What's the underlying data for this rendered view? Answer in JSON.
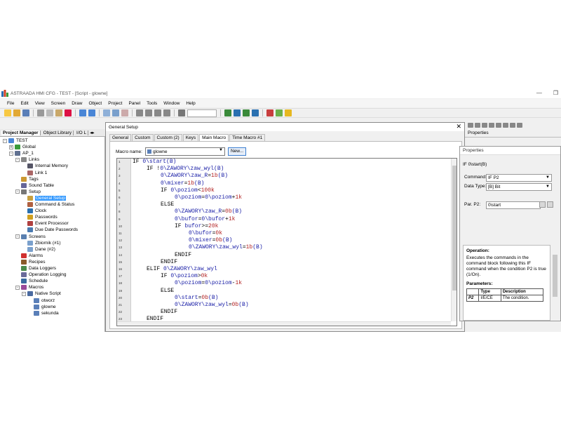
{
  "window": {
    "title": "ASTRAADA HMI CFG - TEST - [Script - glowne]",
    "menu": [
      "File",
      "Edit",
      "View",
      "Screen",
      "Draw",
      "Object",
      "Project",
      "Panel",
      "Tools",
      "Window",
      "Help"
    ]
  },
  "project_manager": {
    "tabs": [
      "Project Manager",
      "Object Library",
      "I/O L"
    ],
    "tree": [
      {
        "label": "TEST",
        "level": 0,
        "icon": "project-icon",
        "exp": "-"
      },
      {
        "label": "Global",
        "level": 1,
        "icon": "globe-icon",
        "exp": "+"
      },
      {
        "label": "AP_1",
        "level": 1,
        "icon": "device-icon",
        "exp": "-"
      },
      {
        "label": "Links",
        "level": 2,
        "icon": "links-icon",
        "exp": "-"
      },
      {
        "label": "Internal Memory",
        "level": 3,
        "icon": "memory-icon",
        "exp": ""
      },
      {
        "label": "Link 1",
        "level": 3,
        "icon": "link-icon",
        "exp": ""
      },
      {
        "label": "Tags",
        "level": 2,
        "icon": "tags-icon",
        "exp": ""
      },
      {
        "label": "Sound Table",
        "level": 2,
        "icon": "sound-icon",
        "exp": ""
      },
      {
        "label": "Setup",
        "level": 2,
        "icon": "setup-icon",
        "exp": "-"
      },
      {
        "label": "General Setup",
        "level": 3,
        "icon": "general-setup-icon",
        "exp": "",
        "selected": true
      },
      {
        "label": "Command & Status",
        "level": 3,
        "icon": "command-icon",
        "exp": ""
      },
      {
        "label": "Clock",
        "level": 3,
        "icon": "clock-icon",
        "exp": ""
      },
      {
        "label": "Passwords",
        "level": 3,
        "icon": "key-icon",
        "exp": ""
      },
      {
        "label": "Event Processor",
        "level": 3,
        "icon": "event-icon",
        "exp": ""
      },
      {
        "label": "Due Date Passwords",
        "level": 3,
        "icon": "calendar-icon",
        "exp": ""
      },
      {
        "label": "Screens",
        "level": 2,
        "icon": "screens-icon",
        "exp": "-"
      },
      {
        "label": "Zbiornik (#1)",
        "level": 3,
        "icon": "screen-icon",
        "exp": ""
      },
      {
        "label": "Dane (#2)",
        "level": 3,
        "icon": "screen-icon",
        "exp": ""
      },
      {
        "label": "Alarms",
        "level": 2,
        "icon": "alarm-icon",
        "exp": ""
      },
      {
        "label": "Recipes",
        "level": 2,
        "icon": "recipe-icon",
        "exp": ""
      },
      {
        "label": "Data Loggers",
        "level": 2,
        "icon": "logger-icon",
        "exp": ""
      },
      {
        "label": "Operation Logging",
        "level": 2,
        "icon": "oplog-icon",
        "exp": ""
      },
      {
        "label": "Schedule",
        "level": 2,
        "icon": "schedule-icon",
        "exp": ""
      },
      {
        "label": "Macros",
        "level": 2,
        "icon": "macro-icon",
        "exp": "-"
      },
      {
        "label": "Native Script",
        "level": 3,
        "icon": "script-icon",
        "exp": "-"
      },
      {
        "label": "otworz",
        "level": 4,
        "icon": "script-file-icon",
        "exp": ""
      },
      {
        "label": "glowne",
        "level": 4,
        "icon": "script-file-icon",
        "exp": ""
      },
      {
        "label": "sekunda",
        "level": 4,
        "icon": "script-file-icon",
        "exp": ""
      }
    ]
  },
  "dialog": {
    "title": "General Setup",
    "tabs": [
      "General",
      "Custom",
      "Custom (2)",
      "Keys",
      "Main Macro",
      "Time Macro #1"
    ],
    "active_tab": 4,
    "macro_name_label": "Macro name:",
    "macro_name_value": "glowne",
    "new_button": "New...",
    "code": [
      {
        "indent": 0,
        "parts": [
          [
            "kw",
            "IF "
          ],
          [
            "id",
            "0\\start(B)"
          ]
        ]
      },
      {
        "indent": 1,
        "parts": [
          [
            "kw",
            "IF !"
          ],
          [
            "id",
            "0\\ZAWORY\\zaw_wyl(B)"
          ]
        ]
      },
      {
        "indent": 2,
        "parts": [
          [
            "id",
            "0\\ZAWORY\\zaw_R"
          ],
          [
            "kw",
            "="
          ],
          [
            "num",
            "1b"
          ],
          [
            "id",
            "(B)"
          ]
        ]
      },
      {
        "indent": 2,
        "parts": [
          [
            "id",
            "0\\mixer"
          ],
          [
            "kw",
            "="
          ],
          [
            "num",
            "1b"
          ],
          [
            "id",
            "(B)"
          ]
        ]
      },
      {
        "indent": 2,
        "parts": [
          [
            "kw",
            "IF "
          ],
          [
            "id",
            "0\\poziom"
          ],
          [
            "kw",
            "<"
          ],
          [
            "num",
            "100k"
          ]
        ]
      },
      {
        "indent": 3,
        "parts": [
          [
            "id",
            "0\\poziom"
          ],
          [
            "kw",
            "="
          ],
          [
            "id",
            "0\\poziom"
          ],
          [
            "kw",
            "+"
          ],
          [
            "num",
            "1k"
          ]
        ]
      },
      {
        "indent": 2,
        "parts": [
          [
            "kw",
            "ELSE"
          ]
        ]
      },
      {
        "indent": 3,
        "parts": [
          [
            "id",
            "0\\ZAWORY\\zaw_R"
          ],
          [
            "kw",
            "="
          ],
          [
            "num",
            "0b"
          ],
          [
            "id",
            "(B)"
          ]
        ]
      },
      {
        "indent": 3,
        "parts": [
          [
            "id",
            "0\\bufor"
          ],
          [
            "kw",
            "="
          ],
          [
            "id",
            "0\\bufor"
          ],
          [
            "kw",
            "+"
          ],
          [
            "num",
            "1k"
          ]
        ]
      },
      {
        "indent": 3,
        "parts": [
          [
            "kw",
            "IF "
          ],
          [
            "id",
            "bufor"
          ],
          [
            "kw",
            ">="
          ],
          [
            "num",
            "20k"
          ]
        ]
      },
      {
        "indent": 4,
        "parts": [
          [
            "id",
            "0\\bufor"
          ],
          [
            "kw",
            "="
          ],
          [
            "num",
            "0k"
          ]
        ]
      },
      {
        "indent": 4,
        "parts": [
          [
            "id",
            "0\\mixer"
          ],
          [
            "kw",
            "="
          ],
          [
            "num",
            "0b"
          ],
          [
            "id",
            "(B)"
          ]
        ]
      },
      {
        "indent": 4,
        "parts": [
          [
            "id",
            "0\\ZAWORY\\zaw_wyl"
          ],
          [
            "kw",
            "="
          ],
          [
            "num",
            "1b"
          ],
          [
            "id",
            "(B)"
          ]
        ]
      },
      {
        "indent": 3,
        "parts": [
          [
            "kw",
            "ENDIF"
          ]
        ]
      },
      {
        "indent": 2,
        "parts": [
          [
            "kw",
            "ENDIF"
          ]
        ]
      },
      {
        "indent": 1,
        "parts": [
          [
            "kw",
            "ELIF "
          ],
          [
            "id",
            "0\\ZAWORY\\zaw_wyl"
          ]
        ]
      },
      {
        "indent": 2,
        "parts": [
          [
            "kw",
            "IF "
          ],
          [
            "id",
            "0\\poziom"
          ],
          [
            "kw",
            ">"
          ],
          [
            "num",
            "0k"
          ]
        ]
      },
      {
        "indent": 3,
        "parts": [
          [
            "id",
            "0\\poziom"
          ],
          [
            "kw",
            "="
          ],
          [
            "id",
            "0\\poziom"
          ],
          [
            "kw",
            "-"
          ],
          [
            "num",
            "1k"
          ]
        ]
      },
      {
        "indent": 2,
        "parts": [
          [
            "kw",
            "ELSE"
          ]
        ]
      },
      {
        "indent": 3,
        "parts": [
          [
            "id",
            "0\\start"
          ],
          [
            "kw",
            "="
          ],
          [
            "num",
            "0b"
          ],
          [
            "id",
            "(B)"
          ]
        ]
      },
      {
        "indent": 3,
        "parts": [
          [
            "id",
            "0\\ZAWORY\\zaw_wyl"
          ],
          [
            "kw",
            "="
          ],
          [
            "num",
            "0b"
          ],
          [
            "id",
            "(B)"
          ]
        ]
      },
      {
        "indent": 2,
        "parts": [
          [
            "kw",
            "ENDIF"
          ]
        ]
      },
      {
        "indent": 1,
        "parts": [
          [
            "kw",
            "ENDIF"
          ]
        ]
      }
    ]
  },
  "properties": {
    "header": "Properties",
    "panel_title": "Properties",
    "condition_text": "IF 0\\start(B)",
    "command_label": "Command:",
    "command_value": "IF P2",
    "datatype_label": "Data Type:",
    "datatype_value": "[B] Bit",
    "par_label": "Par. P2:",
    "par_value": "0\\start",
    "help_title": "Operation:",
    "help_text": "Executes the commands in the command block following this IF command when the condition P2 is true (1/On).",
    "params_title": "Parameters:",
    "params_headers": [
      "",
      "Type",
      "Description"
    ],
    "params_row": [
      "P2",
      "I/E/CE",
      "The condition."
    ]
  },
  "colors": {
    "code_identifier": "#1d22a8",
    "code_number": "#b22222",
    "selection": "#3399ff"
  }
}
